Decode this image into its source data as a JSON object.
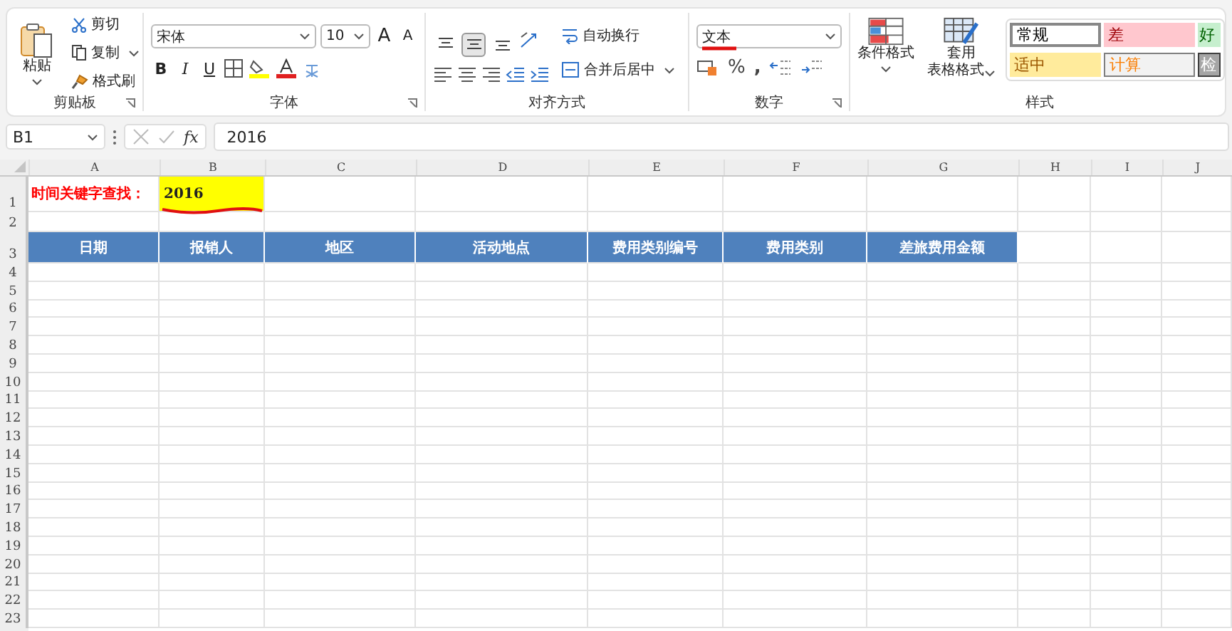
{
  "clipboard": {
    "paste": "粘贴",
    "cut": "剪切",
    "copy": "复制",
    "format_painter": "格式刷",
    "label": "剪贴板"
  },
  "font": {
    "name": "宋体",
    "size": "10",
    "grow": "A",
    "shrink": "A",
    "bold": "B",
    "italic": "I",
    "underline": "U",
    "label": "字体"
  },
  "alignment": {
    "buttons": [
      {
        "kind": "top",
        "selected": false
      },
      {
        "kind": "middle",
        "selected": true
      },
      {
        "kind": "bottom",
        "selected": false
      }
    ],
    "wrap": "自动换行",
    "merge": "合并后居中",
    "label": "对齐方式"
  },
  "number": {
    "format": "文本",
    "percent": "%",
    "comma": ",",
    "label": "数字"
  },
  "styles": {
    "conditional": "条件格式",
    "table_format": [
      "套用",
      "表格格式"
    ],
    "label": "样式",
    "cells": [
      {
        "text": "常规",
        "kind": "normal"
      },
      {
        "text": "差",
        "kind": "bad"
      },
      {
        "text": "好",
        "kind": "good"
      },
      {
        "text": "适中",
        "kind": "neutral"
      },
      {
        "text": "计算",
        "kind": "calc"
      },
      {
        "text": "检",
        "kind": "check"
      }
    ]
  },
  "formula_bar": {
    "name_box": "B1",
    "fx": "fx",
    "value": "2016"
  },
  "sheet": {
    "columns": [
      "A",
      "B",
      "C",
      "D",
      "E",
      "F",
      "G",
      "H",
      "I",
      "J"
    ],
    "rows": [
      {
        "label": "1",
        "kind": "search",
        "cells": [
          "时间关键字查找：",
          "2016"
        ]
      },
      {
        "label": "2",
        "kind": "blank"
      },
      {
        "label": "3",
        "kind": "header",
        "cells": [
          "日期",
          "报销人",
          "地区",
          "活动地点",
          "费用类别编号",
          "费用类别",
          "差旅费用金额"
        ]
      },
      {
        "label": "4",
        "kind": "blank"
      },
      {
        "label": "5",
        "kind": "blank"
      },
      {
        "label": "6",
        "kind": "blank"
      },
      {
        "label": "7",
        "kind": "blank"
      },
      {
        "label": "8",
        "kind": "blank"
      },
      {
        "label": "9",
        "kind": "blank"
      },
      {
        "label": "10",
        "kind": "blank"
      },
      {
        "label": "11",
        "kind": "blank"
      },
      {
        "label": "12",
        "kind": "blank"
      },
      {
        "label": "13",
        "kind": "blank"
      },
      {
        "label": "14",
        "kind": "blank"
      },
      {
        "label": "15",
        "kind": "blank"
      },
      {
        "label": "16",
        "kind": "blank"
      },
      {
        "label": "17",
        "kind": "blank"
      },
      {
        "label": "18",
        "kind": "blank"
      },
      {
        "label": "19",
        "kind": "blank"
      },
      {
        "label": "20",
        "kind": "blank"
      },
      {
        "label": "21",
        "kind": "blank"
      },
      {
        "label": "22",
        "kind": "blank"
      },
      {
        "label": "23",
        "kind": "blank"
      }
    ]
  }
}
